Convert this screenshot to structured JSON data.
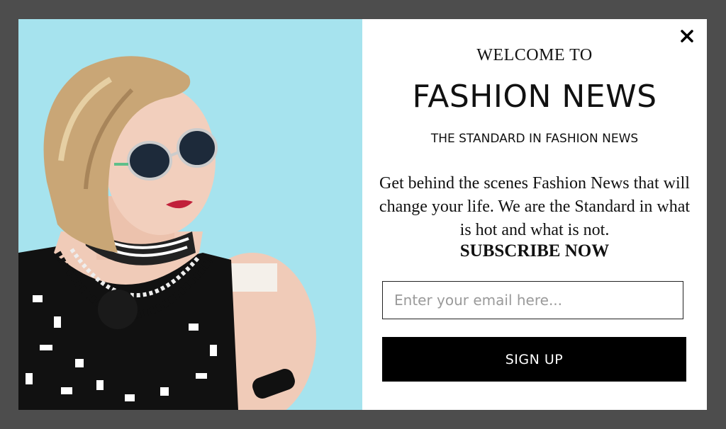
{
  "modal": {
    "close_icon": "close-icon",
    "photo_icon": "woman-portrait-photo",
    "welcome": "WELCOME TO",
    "brand": "FASHION NEWS",
    "tagline": "THE STANDARD IN FASHION NEWS",
    "description": "Get behind the scenes Fashion News that will change your life. We are the Standard in what is hot and what is not.",
    "cta": "SUBSCRIBE NOW",
    "email_placeholder": "Enter your email here...",
    "email_value": "",
    "signup_label": "SIGN UP"
  },
  "colors": {
    "overlay": "#4d4d4d",
    "photo_background": "#a6e3ee",
    "button": "#000000",
    "text": "#111111"
  }
}
